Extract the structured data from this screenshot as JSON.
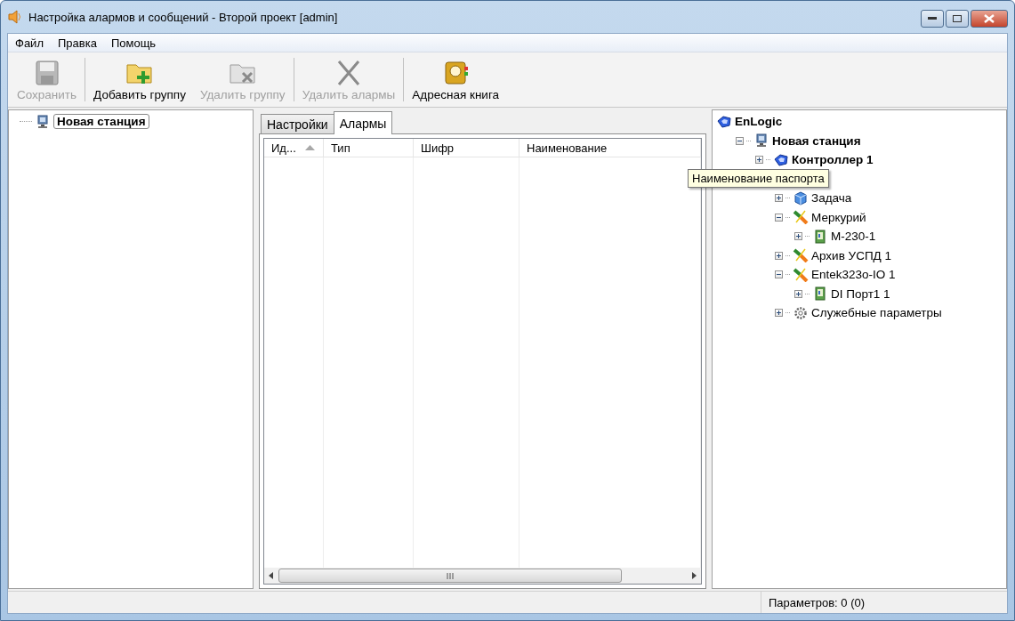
{
  "window": {
    "title": "Настройка алармов и сообщений - Второй проект [admin]"
  },
  "menu": [
    {
      "label": "Файл"
    },
    {
      "label": "Правка"
    },
    {
      "label": "Помощь"
    }
  ],
  "toolbar": [
    {
      "label": "Сохранить",
      "kind": "save",
      "disabled": true
    },
    {
      "label": "Добавить группу",
      "kind": "add-folder",
      "disabled": false
    },
    {
      "label": "Удалить группу",
      "kind": "remove-folder",
      "disabled": true
    },
    {
      "label": "Удалить алармы",
      "kind": "cross",
      "disabled": true
    },
    {
      "label": "Адресная книга",
      "kind": "book",
      "disabled": false
    }
  ],
  "left_tree": [
    {
      "label": "Новая станция",
      "kind": "station",
      "selected": true
    }
  ],
  "tabs": [
    {
      "label": "Настройки",
      "selected": false
    },
    {
      "label": "Алармы",
      "selected": true
    }
  ],
  "table": {
    "columns": [
      {
        "label": "Ид...",
        "sorted": true
      },
      {
        "label": "Тип",
        "sorted": false
      },
      {
        "label": "Шифр",
        "sorted": false
      },
      {
        "label": "Наименование",
        "sorted": false
      }
    ]
  },
  "right_tree": [
    {
      "label": "EnLogic",
      "kind": "controller",
      "bold": true,
      "children": [
        {
          "label": "Новая станция",
          "kind": "station",
          "bold": true,
          "expanded": true,
          "children": [
            {
              "label": "Контроллер 1",
              "kind": "controller",
              "bold": true,
              "expanded": false,
              "children": [
                {
                  "label": "Задача",
                  "kind": "cube",
                  "bold": false,
                  "expanded": false
                },
                {
                  "label": "Меркурий",
                  "kind": "plug",
                  "bold": false,
                  "expanded": true,
                  "children": [
                    {
                      "label": "М-230-1",
                      "kind": "board",
                      "bold": false,
                      "expanded": false
                    }
                  ]
                },
                {
                  "label": "Архив УСПД 1",
                  "kind": "plug",
                  "bold": false,
                  "expanded": false
                },
                {
                  "label": "Entek323o-IO 1",
                  "kind": "plug",
                  "bold": false,
                  "expanded": true,
                  "children": [
                    {
                      "label": "DI Порт1 1",
                      "kind": "board",
                      "bold": false,
                      "expanded": false
                    }
                  ]
                },
                {
                  "label": "Служебные параметры",
                  "kind": "gear",
                  "bold": false,
                  "expanded": false
                }
              ]
            }
          ]
        }
      ]
    }
  ],
  "tooltip": "Наименование паспорта",
  "status_bar": {
    "text": "Параметров: 0 (0)"
  }
}
